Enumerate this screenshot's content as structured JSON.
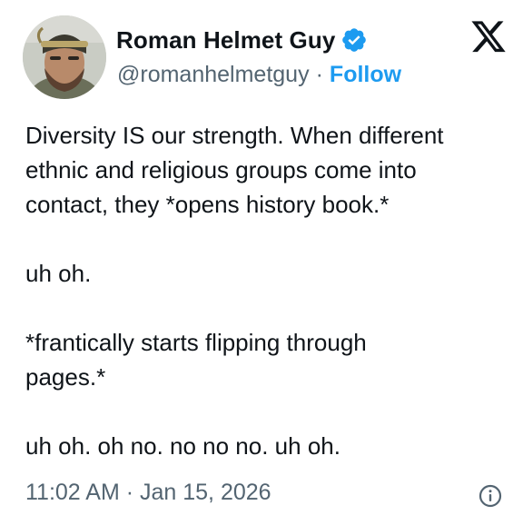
{
  "author": {
    "display_name": "Roman Helmet Guy",
    "handle": "@romanhelmetguy",
    "separator": "·",
    "follow_label": "Follow",
    "verified_icon": "verified-badge-icon",
    "verified_color": "#1d9bf0"
  },
  "brand": {
    "logo_icon": "x-logo-icon"
  },
  "tweet": {
    "lines": [
      "Diversity IS our strength. When different",
      "ethnic and religious groups come into",
      "contact, they *opens history book.*",
      "",
      "uh oh.",
      "",
      "*frantically starts flipping through",
      "pages.*",
      "",
      "uh oh. oh no. no no no. uh oh."
    ]
  },
  "meta": {
    "timestamp": "11:02 AM · Jan 15, 2026",
    "info_icon": "info-icon"
  },
  "colors": {
    "text": "#0f1419",
    "secondary": "#536471",
    "accent": "#1d9bf0"
  }
}
